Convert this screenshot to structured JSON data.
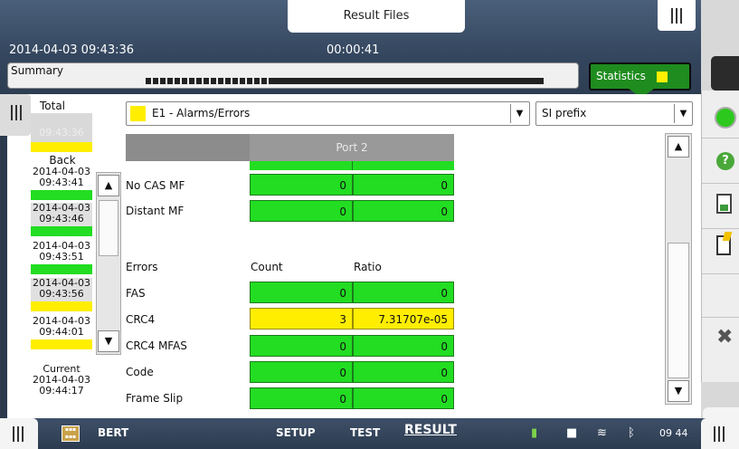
{
  "header": {
    "result_files_tab": "Result Files",
    "datetime": "2014-04-03 09:43:36",
    "elapsed": "00:00:41",
    "summary_label": "Summary",
    "statistics_button": "Statistics"
  },
  "history": {
    "total_label": "Total",
    "total_time": "09:43:36",
    "back_label": "Back",
    "entries": [
      {
        "date": "2014-04-03",
        "time": "09:43:41",
        "status_color": "#22dd22"
      },
      {
        "date": "2014-04-03",
        "time": "09:43:46",
        "status_color": "#22dd22"
      },
      {
        "date": "2014-04-03",
        "time": "09:43:51",
        "status_color": "#22dd22"
      },
      {
        "date": "2014-04-03",
        "time": "09:43:56",
        "status_color": "#ffee00"
      },
      {
        "date": "2014-04-03",
        "time": "09:44:01",
        "status_color": "#ffee00"
      }
    ],
    "current_label": "Current",
    "current_date": "2014-04-03",
    "current_time": "09:44:17"
  },
  "toolbar": {
    "view_select": "E1 - Alarms/Errors",
    "prefix_select": "SI prefix"
  },
  "table": {
    "port_header": "Port 2",
    "alarm_rows": [
      {
        "label": "No CAS MF",
        "v1": "0",
        "v2": "0"
      },
      {
        "label": "Distant MF",
        "v1": "0",
        "v2": "0"
      }
    ],
    "errors_header": {
      "label": "Errors",
      "col1": "Count",
      "col2": "Ratio"
    },
    "error_rows": [
      {
        "label": "FAS",
        "count": "0",
        "ratio": "0",
        "color": "#22dd22"
      },
      {
        "label": "CRC4",
        "count": "3",
        "ratio": "7.31707e-05",
        "color": "#ffee00"
      },
      {
        "label": "CRC4 MFAS",
        "count": "0",
        "ratio": "0",
        "color": "#22dd22"
      },
      {
        "label": "Code",
        "count": "0",
        "ratio": "0",
        "color": "#22dd22"
      },
      {
        "label": "Frame Slip",
        "count": "0",
        "ratio": "0",
        "color": "#22dd22"
      }
    ]
  },
  "taskbar": {
    "app_name": "BERT",
    "tabs": [
      "SETUP",
      "TEST",
      "RESULT"
    ],
    "clock": "09 44"
  },
  "colors": {
    "ok": "#22dd22",
    "warn": "#ffee00",
    "accent": "#1f8c1f"
  }
}
